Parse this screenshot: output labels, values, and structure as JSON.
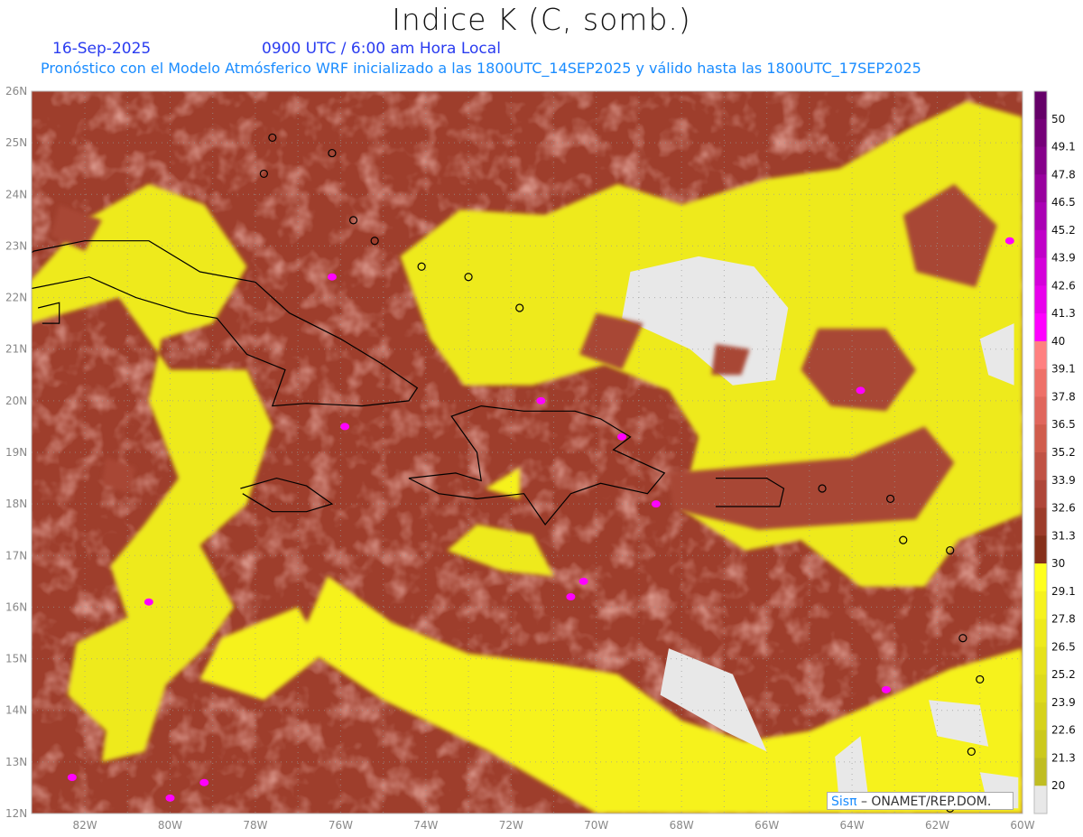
{
  "header": {
    "title": "Indice K (C, somb.)",
    "date": "16-Sep-2025",
    "time": "0900 UTC / 6:00 am Hora Local",
    "subtitle": "Pronóstico con el Modelo Atmósferico WRF inicializado a las 1800UTC_14SEP2025 y válido hasta las  1800UTC_17SEP2025"
  },
  "axes": {
    "lat_labels": [
      "12N",
      "13N",
      "14N",
      "15N",
      "16N",
      "17N",
      "18N",
      "19N",
      "20N",
      "21N",
      "22N",
      "23N",
      "24N",
      "25N",
      "26N"
    ],
    "lon_labels": [
      "82W",
      "80W",
      "78W",
      "76W",
      "74W",
      "72W",
      "70W",
      "68W",
      "66W",
      "64W",
      "62W",
      "60W"
    ],
    "lon_range": [
      -83.25,
      -60
    ],
    "lat_range": [
      12,
      26
    ]
  },
  "colorbar": {
    "labels": [
      "50",
      "49.1",
      "47.8",
      "46.5",
      "45.2",
      "43.9",
      "42.6",
      "41.3",
      "40",
      "39.1",
      "37.8",
      "36.5",
      "35.2",
      "33.9",
      "32.6",
      "31.3",
      "30",
      "29.1",
      "27.8",
      "26.5",
      "25.2",
      "23.9",
      "22.6",
      "21.3",
      "20"
    ],
    "colors": [
      "#650068",
      "#750078",
      "#85008a",
      "#98009e",
      "#aa00b4",
      "#c000c8",
      "#d400da",
      "#e800ec",
      "#ff00ff",
      "#ff8080",
      "#ee7068",
      "#e0665c",
      "#d05c4c",
      "#c05244",
      "#ae4638",
      "#9c3c2a",
      "#86301a",
      "#ffff1e",
      "#f6f21e",
      "#eeea1c",
      "#e6e21a",
      "#dedb1a",
      "#d6d21a",
      "#ccc91c",
      "#c0bd22",
      "#e8e8e8"
    ]
  },
  "credit": {
    "logo": "Sisπ",
    "text": "– ONAMET/REP.DOM."
  }
}
